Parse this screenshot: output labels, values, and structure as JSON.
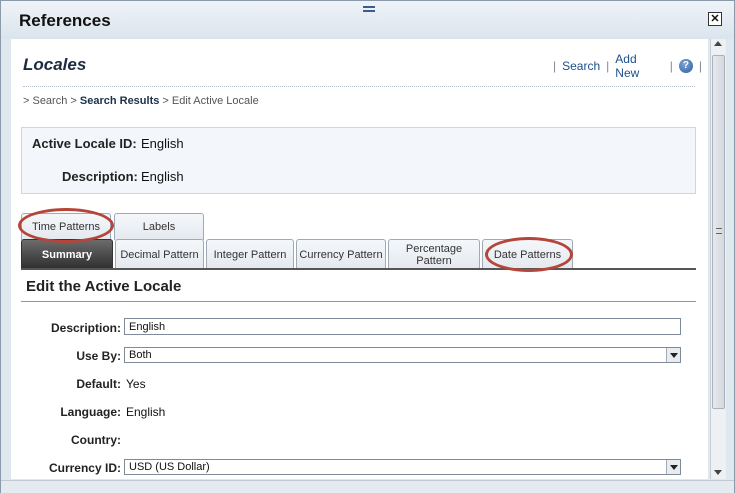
{
  "window": {
    "title": "References",
    "close_glyph": "✕"
  },
  "header": {
    "page_title": "Locales",
    "links": [
      {
        "label": "Search"
      },
      {
        "label": "Add New"
      }
    ],
    "help_glyph": "?"
  },
  "breadcrumb": {
    "prefix1": "> Search > ",
    "current_link": "Search Results",
    "suffix": " > Edit Active Locale"
  },
  "info": {
    "id_label": "Active Locale ID:",
    "id_value": "English",
    "desc_label": "Description:",
    "desc_value": "English"
  },
  "tabs_row1": [
    {
      "label": "Time Patterns"
    },
    {
      "label": "Labels"
    }
  ],
  "tabs_row2": [
    {
      "label": "Summary"
    },
    {
      "label": "Decimal Pattern"
    },
    {
      "label": "Integer Pattern"
    },
    {
      "label": "Currency Pattern"
    },
    {
      "label": "Percentage Pattern"
    },
    {
      "label": "Date Patterns"
    }
  ],
  "section": {
    "title": "Edit the Active Locale"
  },
  "form": {
    "description": {
      "label": "Description:",
      "value": "English"
    },
    "use_by": {
      "label": "Use By:",
      "value": "Both"
    },
    "default": {
      "label": "Default:",
      "value": "Yes"
    },
    "language": {
      "label": "Language:",
      "value": "English"
    },
    "country": {
      "label": "Country:",
      "value": ""
    },
    "currency_id": {
      "label": "Currency ID:",
      "value": "USD (US Dollar)"
    }
  },
  "colors": {
    "highlight": "#b5453a",
    "link": "#1d4f8c",
    "active_tab": "#2e2e2e"
  },
  "icons": {
    "close": "close-icon",
    "help": "help-icon",
    "grip": "drag-grip-icon"
  }
}
